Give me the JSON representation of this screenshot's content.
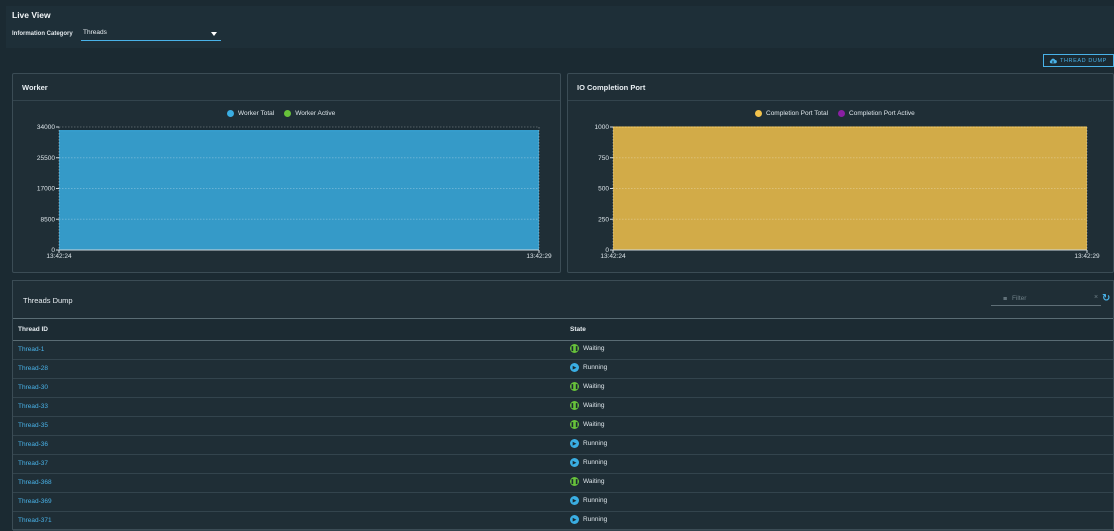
{
  "page": {
    "title": "Live View",
    "category_label": "Information Category",
    "category_value": "Threads",
    "thread_dump_button": "THREAD DUMP"
  },
  "worker_chart": {
    "title": "Worker",
    "chart_data": {
      "type": "area",
      "x": [
        "13:42:24",
        "13:42:29"
      ],
      "series": [
        {
          "name": "Worker Total",
          "color": "#3aaee3",
          "values": [
            33000,
            33000
          ]
        },
        {
          "name": "Worker Active",
          "color": "#67c23a",
          "values": [
            0,
            0
          ]
        }
      ],
      "yticks": [
        "34000",
        "25500",
        "17000",
        "8500",
        "0"
      ],
      "ylim": [
        0,
        34000
      ],
      "legend": "top-center",
      "grid": true
    }
  },
  "io_chart": {
    "title": "IO Completion Port",
    "chart_data": {
      "type": "area",
      "x": [
        "13:42:24",
        "13:42:29"
      ],
      "series": [
        {
          "name": "Completion Port Total",
          "color": "#f2c24c",
          "values": [
            1000,
            1000
          ]
        },
        {
          "name": "Completion Port Active",
          "color": "#8a1fa4",
          "values": [
            0,
            0
          ]
        }
      ],
      "yticks": [
        "1000",
        "750",
        "500",
        "250",
        "0"
      ],
      "ylim": [
        0,
        1000
      ],
      "legend": "top-center",
      "grid": true
    }
  },
  "threads": {
    "title": "Threads Dump",
    "filter_placeholder": "Filter",
    "columns": [
      "Thread ID",
      "State"
    ],
    "rows": [
      {
        "id": "Thread-1",
        "state": "Waiting"
      },
      {
        "id": "Thread-28",
        "state": "Running"
      },
      {
        "id": "Thread-30",
        "state": "Waiting"
      },
      {
        "id": "Thread-33",
        "state": "Waiting"
      },
      {
        "id": "Thread-35",
        "state": "Waiting"
      },
      {
        "id": "Thread-36",
        "state": "Running"
      },
      {
        "id": "Thread-37",
        "state": "Running"
      },
      {
        "id": "Thread-368",
        "state": "Waiting"
      },
      {
        "id": "Thread-369",
        "state": "Running"
      },
      {
        "id": "Thread-371",
        "state": "Running"
      }
    ],
    "state_colors": {
      "Waiting": "#67c23a",
      "Running": "#3aaee3"
    }
  }
}
